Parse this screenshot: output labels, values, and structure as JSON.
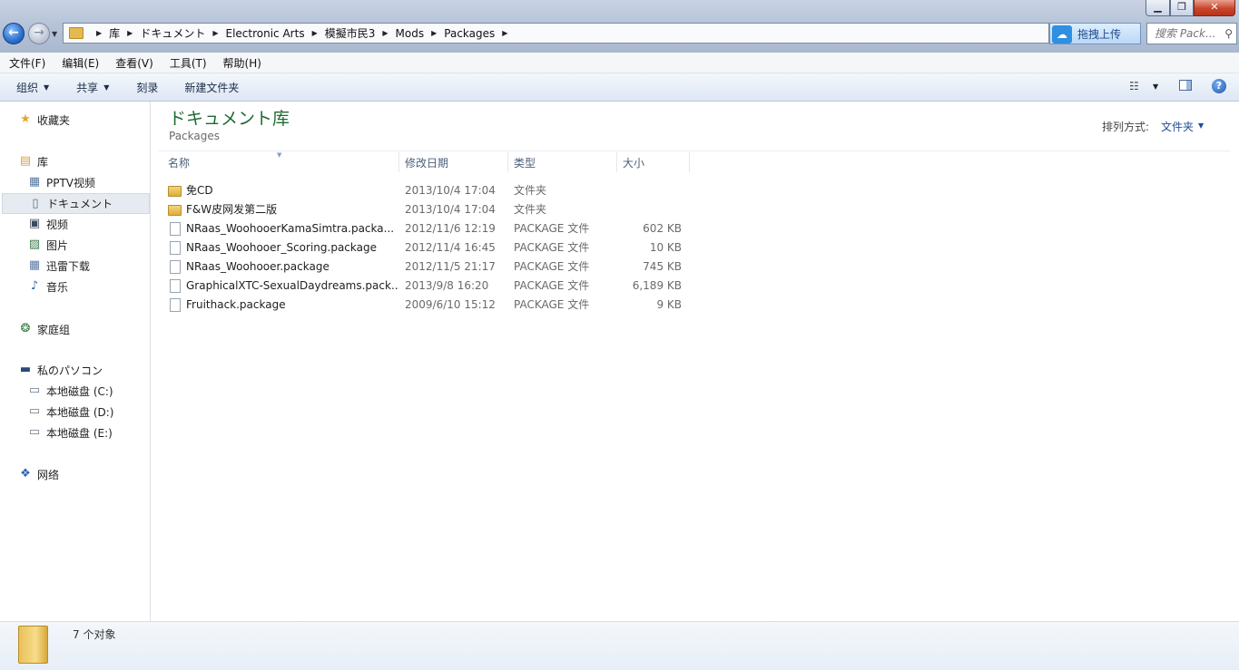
{
  "window": {
    "controls": {
      "minimize": "▁",
      "maximize": "❐",
      "close": "✕"
    }
  },
  "address": {
    "crumbs": [
      "库",
      "ドキュメント",
      "Electronic Arts",
      "模擬市民3",
      "Mods",
      "Packages"
    ],
    "separator": "▶"
  },
  "upload": {
    "label": "拖拽上传"
  },
  "search": {
    "placeholder": "搜索 Pack..."
  },
  "menu": [
    "文件(F)",
    "编辑(E)",
    "查看(V)",
    "工具(T)",
    "帮助(H)"
  ],
  "toolbar": {
    "organize": "组织",
    "share": "共享",
    "burn": "刻录",
    "new_folder": "新建文件夹",
    "arrow": "▼"
  },
  "nav": {
    "favorites": "收藏夹",
    "libraries": "库",
    "lib_items": [
      "PPTV视频",
      "ドキュメント",
      "视频",
      "图片",
      "迅雷下载",
      "音乐"
    ],
    "homegroup": "家庭组",
    "computer": "私のパソコン",
    "drives": [
      "本地磁盘 (C:)",
      "本地磁盘 (D:)",
      "本地磁盘 (E:)"
    ],
    "network": "网络"
  },
  "library": {
    "title": "ドキュメント库",
    "subtitle": "Packages",
    "arrange_label": "排列方式:",
    "arrange_value": "文件夹"
  },
  "columns": [
    "名称",
    "修改日期",
    "类型",
    "大小"
  ],
  "files": [
    {
      "name": "免CD",
      "date": "2013/10/4 17:04",
      "type": "文件夹",
      "size": "",
      "kind": "folder"
    },
    {
      "name": "F&W皮网发第二版",
      "date": "2013/10/4 17:04",
      "type": "文件夹",
      "size": "",
      "kind": "folder"
    },
    {
      "name": "NRaas_WoohooerKamaSimtra.packa...",
      "date": "2012/11/6 12:19",
      "type": "PACKAGE 文件",
      "size": "602 KB",
      "kind": "file"
    },
    {
      "name": "NRaas_Woohooer_Scoring.package",
      "date": "2012/11/4 16:45",
      "type": "PACKAGE 文件",
      "size": "10 KB",
      "kind": "file"
    },
    {
      "name": "NRaas_Woohooer.package",
      "date": "2012/11/5 21:17",
      "type": "PACKAGE 文件",
      "size": "745 KB",
      "kind": "file"
    },
    {
      "name": "GraphicalXTC-SexualDaydreams.pack...",
      "date": "2013/9/8 16:20",
      "type": "PACKAGE 文件",
      "size": "6,189 KB",
      "kind": "file"
    },
    {
      "name": "Fruithack.package",
      "date": "2009/6/10 15:12",
      "type": "PACKAGE 文件",
      "size": "9 KB",
      "kind": "file"
    }
  ],
  "status": {
    "count": "7 个对象"
  },
  "colors": {
    "accent": "#1e6b34",
    "link": "#1f4e96"
  }
}
